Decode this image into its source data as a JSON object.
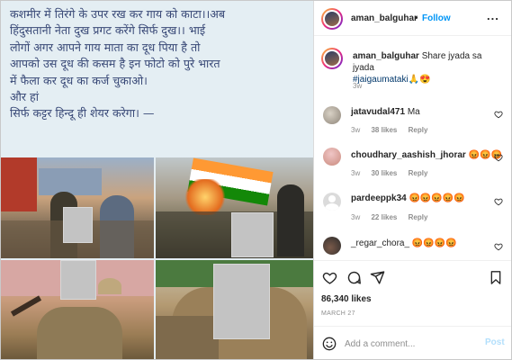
{
  "post_text": {
    "lines": [
      "कशमीर में तिरंगे के उपर रख कर गाय को काटा।।अब",
      "हिंदुसतानी नेता दुख प्रगट करेंगे सिर्फ दुख।। भाई",
      "लोगों अगर आपने गाय माता का दूध पिया है तो",
      "आपको उस दूध की कसम है इन फोटो को पुरे भारत",
      "में फैला कर दूध का कर्ज चुकाओ।",
      "और हां",
      "सिर्फ कट्टर हिन्दू ही शेयर करेगा। —"
    ]
  },
  "header": {
    "username": "aman_balguhar",
    "separator": "•",
    "follow_label": "Follow",
    "more_label": "..."
  },
  "caption": {
    "username": "aman_balguhar",
    "text": "Share jyada sa jyada",
    "hashtag": "#jaigaumataki",
    "emoji": "🙏😍",
    "time": "3w"
  },
  "comments": [
    {
      "username": "jatavudal471",
      "text": "Ma",
      "time": "3w",
      "likes": "38 likes",
      "reply": "Reply"
    },
    {
      "username": "choudhary_aashish_jhorar",
      "text": "😡😡😡",
      "time": "3w",
      "likes": "30 likes",
      "reply": "Reply"
    },
    {
      "username": "pardeeppk34",
      "text": "😡😡😡😡😡",
      "time": "3w",
      "likes": "22 likes",
      "reply": "Reply"
    },
    {
      "username": "_regar_chora_",
      "text": "😡😡😡😡",
      "time": "",
      "likes": "",
      "reply": ""
    }
  ],
  "actions": {
    "likes": "86,340 likes",
    "date": "MARCH 27",
    "add_comment_placeholder": "Add a comment...",
    "post_label": "Post"
  },
  "colors": {
    "accent": "#0095f6",
    "post_text": "#3a4a78"
  }
}
